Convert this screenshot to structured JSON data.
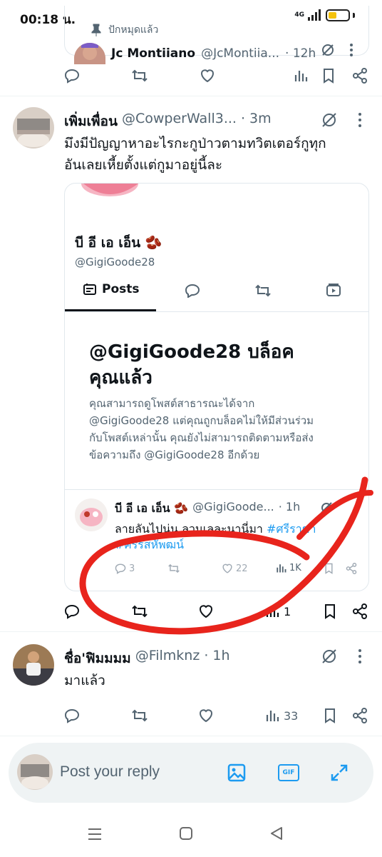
{
  "status_bar": {
    "time": "00:18 น.",
    "network": "4G"
  },
  "top_tweet": {
    "pinned_label": "ปักหมุดแล้ว",
    "author_name": "Jc Montiiano",
    "author_handle": "@JcMontiia...",
    "time": "· 12h"
  },
  "tweet1": {
    "name": "เพิ่มเพื่อน",
    "handle": "@CowperWall3...",
    "time": "· 3m",
    "text_line1": "มึงมีปัญญาหาอะไรกะกูป่าวตามทวิตเตอร์กูทุก",
    "text_line2": "อันเลยเหี้ยตั้งแต่กูมาอยู่นี้ละ",
    "quote": {
      "profile_name": "บี อี เอ เอ็น 🫘",
      "profile_handle": "@GigiGoode28",
      "tab_posts": "Posts",
      "blocked_title_line1": "@GigiGoode28 บล็อค",
      "blocked_title_line2": "คุณแล้ว",
      "blocked_body_line1": "คุณสามารถดูโพสต์สาธารณะได้จาก",
      "blocked_body_line2": "@GigiGoode28 แต่คุณถูกบล็อคไม่ให้มีส่วนร่วม",
      "blocked_body_line3": "กับโพสต์เหล่านั้น คุณยังไม่สามารถติดตามหรือส่ง",
      "blocked_body_line4": "ข้อความถึง @GigiGoode28 อีกด้วย",
      "inner": {
        "name": "บี อี เอ เอ็น 🫘",
        "handle": "@GigiGoode...",
        "time": "· 1h",
        "text_line1": "ลายลันไปนุ่น ลวนเลละนานี่มา ",
        "hashtag1": "#ศรีราชา",
        "hashtag2": "#ศรีรสหัพฒน์",
        "replies": "3",
        "likes": "22",
        "views": "1K"
      }
    },
    "views": "1"
  },
  "tweet2": {
    "name": "ชื่อ'ฟิมมมม",
    "handle": "@Filmknz",
    "time": "· 1h",
    "text": "มาแล้ว",
    "views": "33"
  },
  "composer": {
    "placeholder": "Post your reply",
    "gif_label": "GIF"
  },
  "colors": {
    "accent": "#1d9bf0",
    "muted": "#536471",
    "annotation": "#e8241c"
  }
}
